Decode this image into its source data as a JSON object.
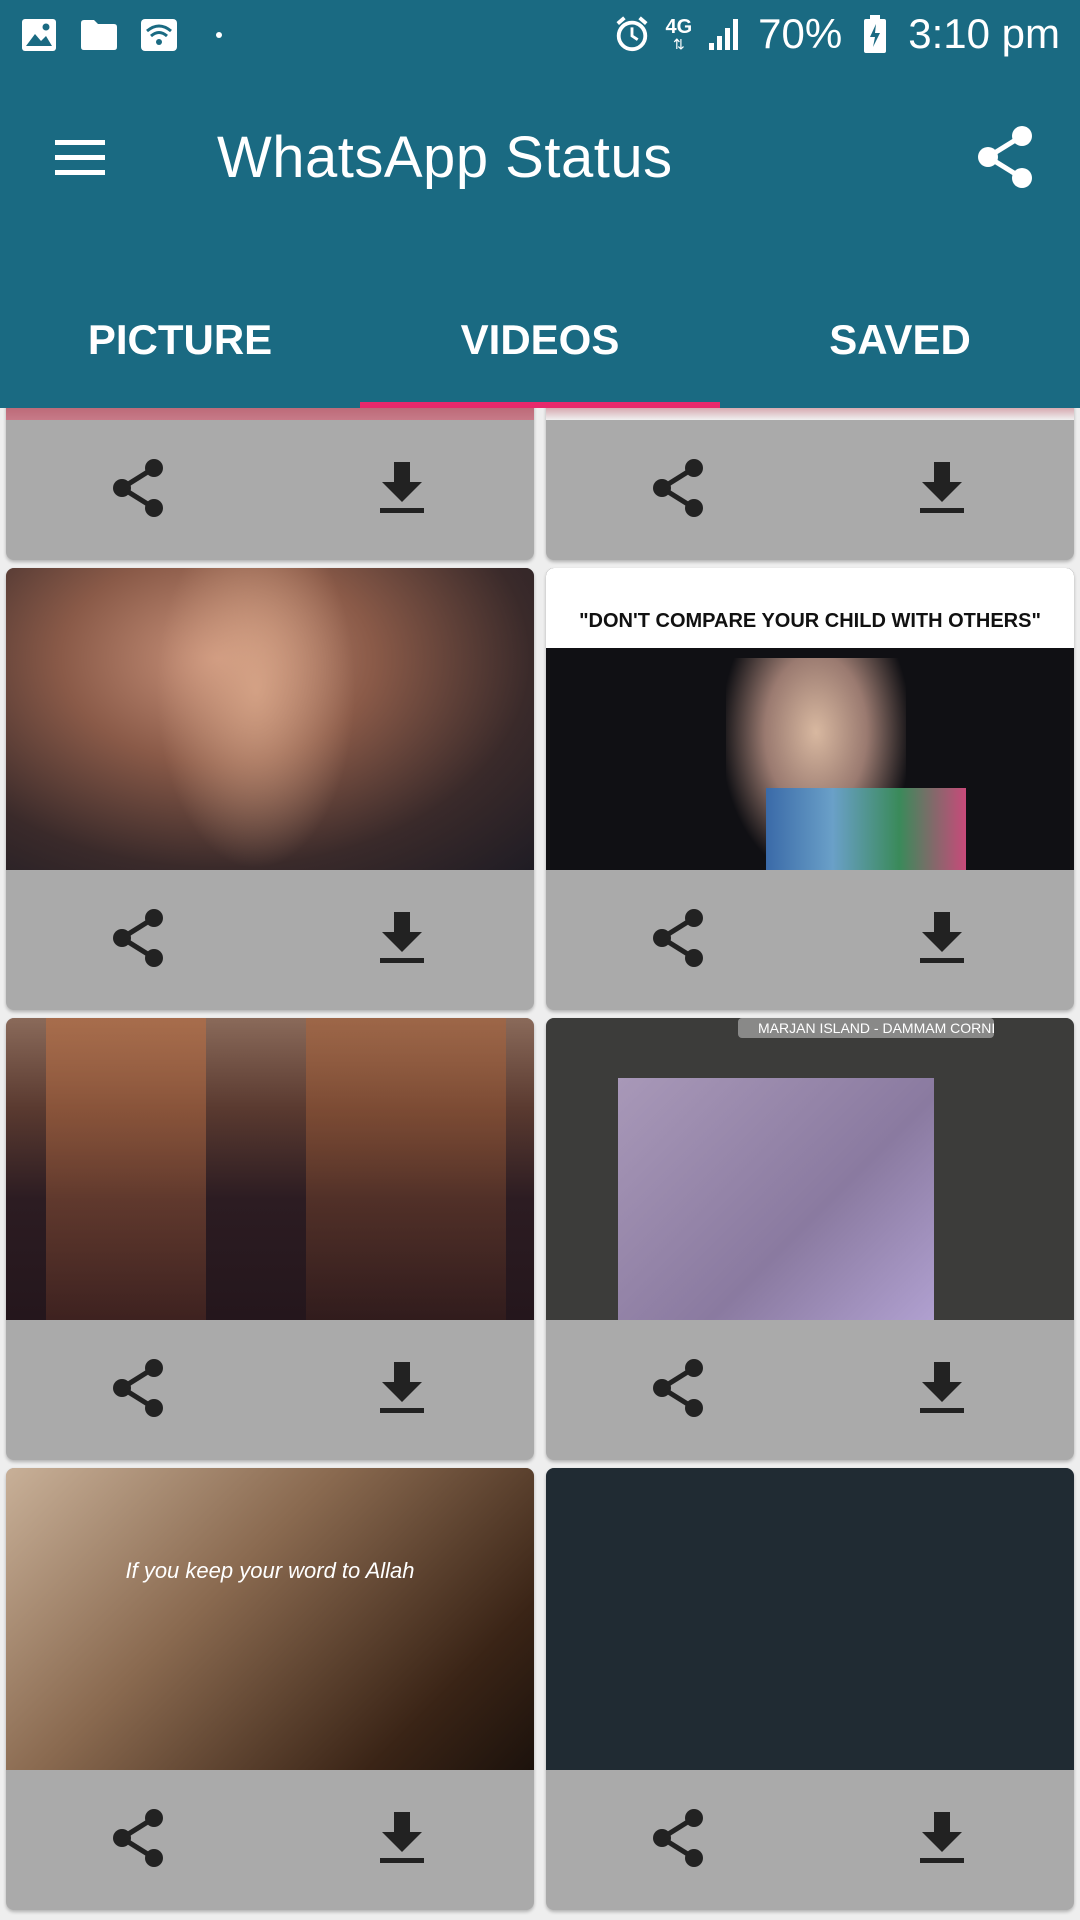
{
  "status_bar": {
    "battery": "70%",
    "time": "3:10 pm",
    "network": "4G",
    "icons": [
      "image-icon",
      "folder-icon",
      "wifi-icon",
      "dot-icon",
      "alarm-icon",
      "network-4g-icon",
      "signal-icon",
      "battery-charging-icon"
    ]
  },
  "app_bar": {
    "title": "WhatsApp Status",
    "menu_icon": "hamburger-menu-icon",
    "share_icon": "share-icon"
  },
  "tabs": [
    {
      "label": "PICTURE",
      "active": false
    },
    {
      "label": "VIDEOS",
      "active": true
    },
    {
      "label": "SAVED",
      "active": false
    }
  ],
  "colors": {
    "primary": "#1a6a82",
    "accent": "#e8296b",
    "card_action_bg": "#aaaaaa",
    "icon": "#222222"
  },
  "videos": [
    {
      "id": "v1",
      "caption": "",
      "watermark": ""
    },
    {
      "id": "v2",
      "caption": "",
      "watermark": ""
    },
    {
      "id": "v3",
      "caption": "",
      "watermark": ""
    },
    {
      "id": "v4",
      "caption": "\"DON'T COMPARE YOUR CHILD WITH OTHERS\"",
      "watermark": ""
    },
    {
      "id": "v5",
      "caption": "",
      "watermark": ""
    },
    {
      "id": "v6",
      "caption": "",
      "watermark": "MARJAN ISLAND - DAMMAM CORNI..."
    },
    {
      "id": "v7",
      "caption": "If you keep your word to Allah",
      "watermark": ""
    },
    {
      "id": "v8",
      "caption": "",
      "watermark": ""
    }
  ],
  "card_actions": {
    "share_icon": "share-icon",
    "download_icon": "download-icon"
  }
}
